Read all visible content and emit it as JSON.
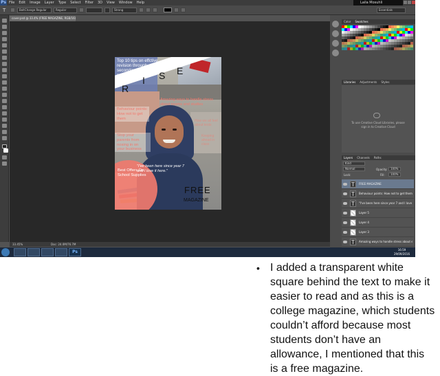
{
  "app": {
    "logo": "Ps",
    "menu": [
      "File",
      "Edit",
      "Image",
      "Layer",
      "Type",
      "Select",
      "Filter",
      "3D",
      "View",
      "Window",
      "Help"
    ],
    "user": "Laila Mosuhli"
  },
  "options": {
    "tool_glyph": "T",
    "font_family": "BoltChange Regular",
    "font_style": "Regular",
    "antialias": "Strong",
    "workspace": "Essentials"
  },
  "document": {
    "tab_title": "cover.psd @ 33.4% (FREE MAGAZINE, RGB/16)",
    "zoom": "33.45%",
    "doc_size": "Doc: 24.0M/76.7M"
  },
  "panels": {
    "swatches_tabs": [
      "Color",
      "Swatches"
    ],
    "libraries_tabs": [
      "Libraries",
      "Adjustments",
      "Styles"
    ],
    "libraries_message": "To use Creative Cloud Libraries, please sign in to Creative Cloud",
    "layers_tabs": [
      "Layers",
      "Channels",
      "Paths"
    ],
    "layers_kind": "Kind",
    "blend_mode": "Normal",
    "opacity_label": "Opacity:",
    "opacity_value": "100%",
    "lock_label": "Lock:",
    "fill_label": "Fill:",
    "fill_value": "100%",
    "layers": [
      {
        "name": "FREE MAGAZINE",
        "kind": "text",
        "selected": true
      },
      {
        "name": "Behaviour points: How not to get them ...",
        "kind": "text",
        "selected": false
      },
      {
        "name": "\"I've been here since year 7 and I love it ...",
        "kind": "text",
        "selected": false
      },
      {
        "name": "Layer 5",
        "kind": "pixel",
        "selected": false
      },
      {
        "name": "Layer 4",
        "kind": "pixel",
        "selected": false
      },
      {
        "name": "Layer 3",
        "kind": "pixel",
        "selected": false
      },
      {
        "name": "Amazing ways to handle stress about exams and ...",
        "kind": "text",
        "selected": false
      }
    ]
  },
  "taskbar": {
    "ps_label": "Ps",
    "time": "16:59",
    "date": "29/09/2016"
  },
  "cover": {
    "top_tip": "Top 10 tips on effctive\nrevision through\nsecondary\nschool",
    "title_letters": [
      "R",
      "I",
      "S",
      "E"
    ],
    "stress": "Amazing ways to handle stress\nabout exams and studies",
    "behaviour": "Behaviour points:\nHow not to get\nthem",
    "parents": "Stop your\nparents from\nnosing in on\nyour business",
    "right_faded_1": "How we all feel\nabout tests",
    "right_faded_2": "Keeping\nahead in\nclass",
    "quote": "\"I've been here since year 7\n and I love it here.\"",
    "offers": "Best Offers On\nSchool Supplies",
    "free": "FREE",
    "magazine": "MAGAZINE",
    "colors": {
      "blue_box": "#6d7fb5",
      "salmon": "#f07a6e",
      "hijab": "#2f3e63",
      "free_text": "#111111"
    }
  },
  "caption": {
    "bullet": "•",
    "text": "I added a transparent white square behind the text to make it easier to read and as this is a college magazine, which students couldn’t afford because most students don’t have an allowance, I mentioned that this is a free magazine."
  }
}
